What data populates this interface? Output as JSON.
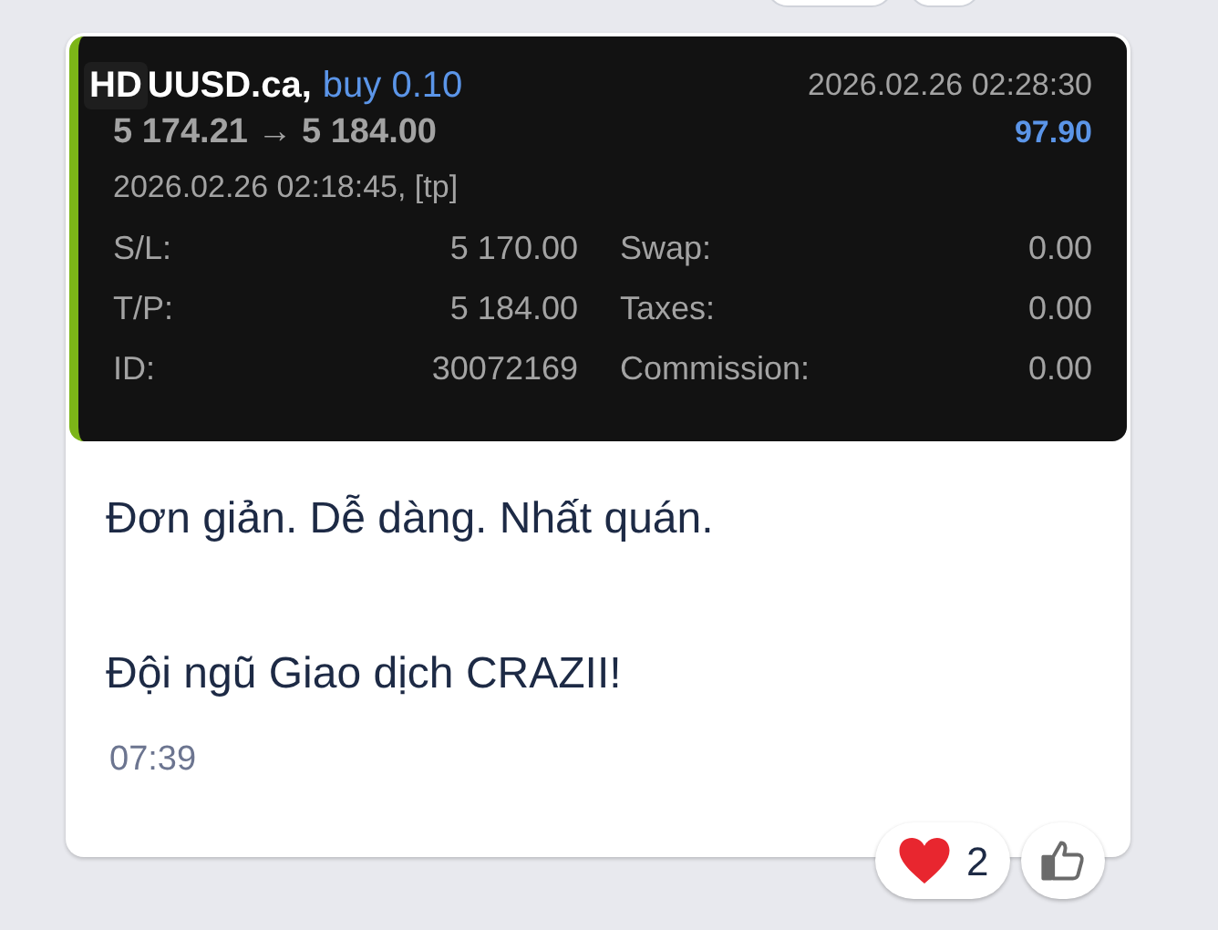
{
  "trade": {
    "badge": "HD",
    "symbol": "UUSD.ca,",
    "side": "buy 0.10",
    "prices": "5 174.21 → 5 184.00",
    "close_time": "2026.02.26 02:28:30",
    "profit": "97.90",
    "open_info": "2026.02.26 02:18:45, [tp]",
    "fields": [
      {
        "label": "S/L:",
        "value": "5 170.00",
        "label2": "Swap:",
        "value2": "0.00"
      },
      {
        "label": "T/P:",
        "value": "5 184.00",
        "label2": "Taxes:",
        "value2": "0.00"
      },
      {
        "label": "ID:",
        "value": "30072169",
        "label2": "Commission:",
        "value2": "0.00"
      }
    ]
  },
  "message": {
    "lines": [
      "Đơn giản. Dễ dàng. Nhất quán.",
      "Đội ngũ Giao dịch CRAZII!"
    ],
    "time": "07:39"
  },
  "reactions": [
    {
      "kind": "heart",
      "count": "2"
    },
    {
      "kind": "like"
    }
  ]
}
